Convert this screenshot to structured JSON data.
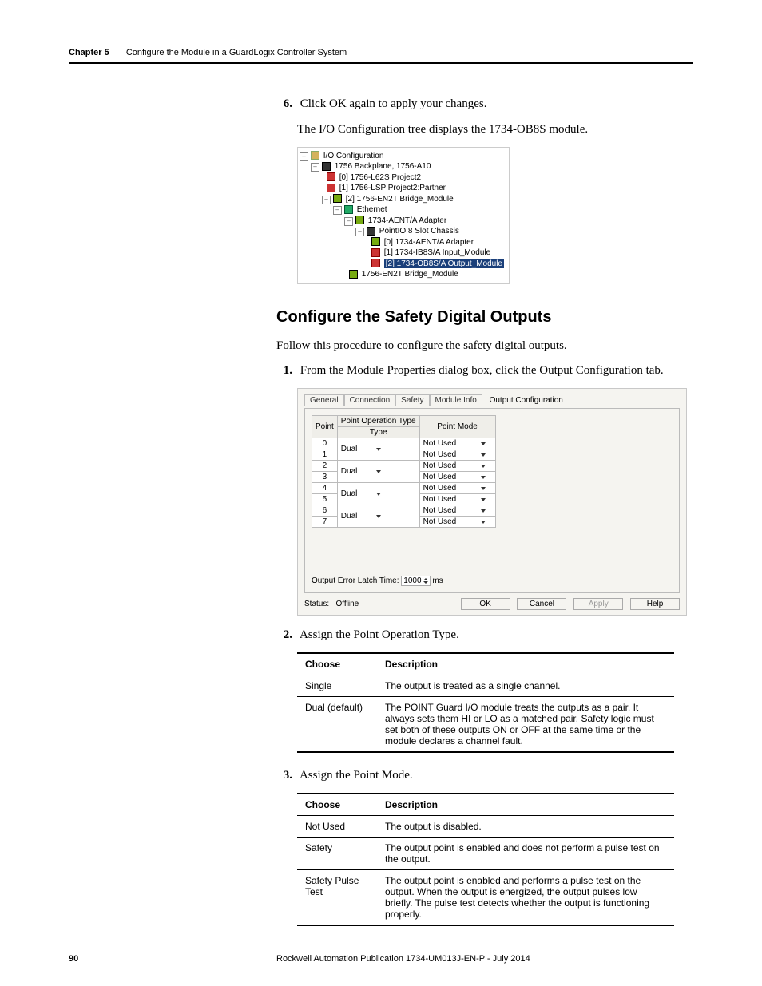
{
  "header": {
    "chapter_label": "Chapter 5",
    "chapter_title": "Configure the Module in a GuardLogix Controller System"
  },
  "step6": {
    "num": "6.",
    "text": "Click OK again to apply your changes.",
    "note": "The I/O Configuration tree displays the 1734-OB8S module."
  },
  "tree": {
    "root": "I/O Configuration",
    "n1": "1756 Backplane, 1756-A10",
    "n2": "[0] 1756-L62S Project2",
    "n3": "[1] 1756-LSP Project2:Partner",
    "n4": "[2] 1756-EN2T Bridge_Module",
    "n5": "Ethernet",
    "n6": "1734-AENT/A Adapter",
    "n7": "PointIO 8 Slot Chassis",
    "n8": "[0] 1734-AENT/A Adapter",
    "n9": "[1] 1734-IB8S/A Input_Module",
    "n10": "[2] 1734-OB8S/A Output_Module",
    "n11": "1756-EN2T Bridge_Module"
  },
  "section_heading": "Configure the Safety Digital Outputs",
  "section_intro": "Follow this procedure to configure the safety digital outputs.",
  "step1": {
    "num": "1.",
    "text": "From the Module Properties dialog box, click the Output Configuration tab."
  },
  "dialog": {
    "tabs": [
      "General",
      "Connection",
      "Safety",
      "Module Info",
      "Output Configuration"
    ],
    "col_point": "Point",
    "col_optype": "Point Operation Type",
    "col_mode": "Point Mode",
    "rows": [
      {
        "pt": "0",
        "op": "Dual",
        "mode": "Not Used"
      },
      {
        "pt": "1",
        "op": "",
        "mode": "Not Used"
      },
      {
        "pt": "2",
        "op": "Dual",
        "mode": "Not Used"
      },
      {
        "pt": "3",
        "op": "",
        "mode": "Not Used"
      },
      {
        "pt": "4",
        "op": "Dual",
        "mode": "Not Used"
      },
      {
        "pt": "5",
        "op": "",
        "mode": "Not Used"
      },
      {
        "pt": "6",
        "op": "Dual",
        "mode": "Not Used"
      },
      {
        "pt": "7",
        "op": "",
        "mode": "Not Used"
      }
    ],
    "latch_label": "Output Error Latch Time:",
    "latch_value": "1000",
    "latch_unit": "ms",
    "status_label": "Status:",
    "status_value": "Offline",
    "btn_ok": "OK",
    "btn_cancel": "Cancel",
    "btn_apply": "Apply",
    "btn_help": "Help"
  },
  "step2": {
    "num": "2.",
    "text": "Assign the Point Operation Type."
  },
  "table1": {
    "h1": "Choose",
    "h2": "Description",
    "rows": [
      {
        "c": "Single",
        "d": "The output is treated as a single channel."
      },
      {
        "c": "Dual (default)",
        "d": "The POINT Guard I/O module treats the outputs as a pair. It always sets them HI or LO as a matched pair. Safety logic must set both of these outputs ON or OFF at the same time or the module declares a channel fault."
      }
    ]
  },
  "step3": {
    "num": "3.",
    "text": "Assign the Point Mode."
  },
  "table2": {
    "h1": "Choose",
    "h2": "Description",
    "rows": [
      {
        "c": "Not Used",
        "d": "The output is disabled."
      },
      {
        "c": "Safety",
        "d": "The output point is enabled and does not perform a pulse test on the output."
      },
      {
        "c": "Safety Pulse Test",
        "d": "The output point is enabled and performs a pulse test on the output. When the output is energized, the output pulses low briefly. The pulse test detects whether the output is functioning properly."
      }
    ]
  },
  "footer": {
    "page": "90",
    "pub": "Rockwell Automation Publication 1734-UM013J-EN-P - July 2014"
  }
}
